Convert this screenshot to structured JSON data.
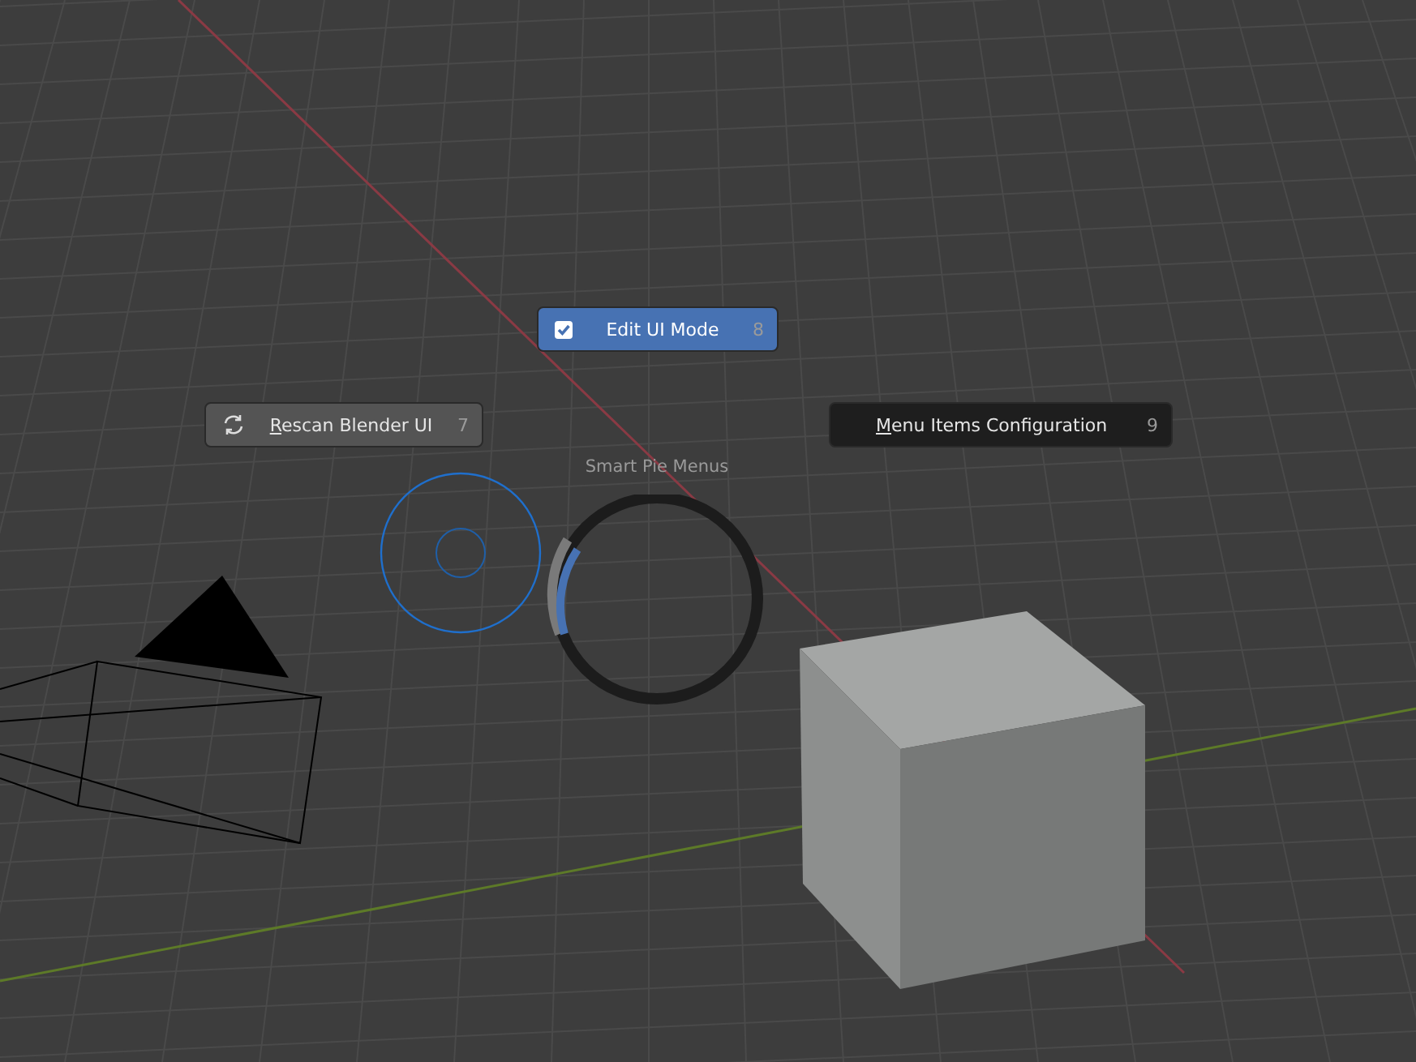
{
  "pie_menu": {
    "title": "Smart Pie Menus",
    "items": [
      {
        "kind": "toggle",
        "label": "Edit UI Mode",
        "shortcut": "8",
        "checked": true,
        "selected": true
      },
      {
        "kind": "operator",
        "label": "Rescan Blender UI",
        "shortcut": "7",
        "selected": false
      },
      {
        "kind": "submenu",
        "label": "Menu Items Configuration",
        "shortcut": "9",
        "selected": false
      }
    ]
  }
}
